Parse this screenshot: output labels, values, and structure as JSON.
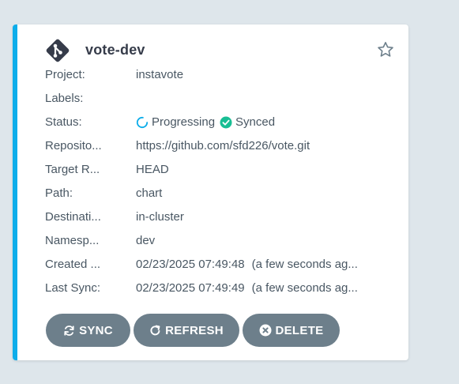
{
  "colors": {
    "accent": "#0dadea",
    "button_bg": "#6d7f8b",
    "synced": "#18be94",
    "progressing": "#0dadea"
  },
  "app": {
    "name": "vote-dev",
    "logo_icon": "git-logo-icon",
    "favorite_icon": "star-outline-icon"
  },
  "fields": {
    "project": {
      "label": "Project:",
      "value": "instavote"
    },
    "labels": {
      "label": "Labels:",
      "value": ""
    },
    "status": {
      "label": "Status:",
      "health": "Progressing",
      "sync": "Synced"
    },
    "repository": {
      "label": "Reposito...",
      "value": "https://github.com/sfd226/vote.git"
    },
    "target_revision": {
      "label": "Target R...",
      "value": "HEAD"
    },
    "path": {
      "label": "Path:",
      "value": "chart"
    },
    "destination": {
      "label": "Destinati...",
      "value": "in-cluster"
    },
    "namespace": {
      "label": "Namesp...",
      "value": "dev"
    },
    "created_at": {
      "label": "Created ...",
      "date": "02/23/2025 07:49:48",
      "ago": "(a few seconds ag..."
    },
    "last_sync": {
      "label": "Last Sync:",
      "date": "02/23/2025 07:49:49",
      "ago": "(a few seconds ag..."
    }
  },
  "actions": {
    "sync": "SYNC",
    "refresh": "REFRESH",
    "delete": "DELETE"
  }
}
